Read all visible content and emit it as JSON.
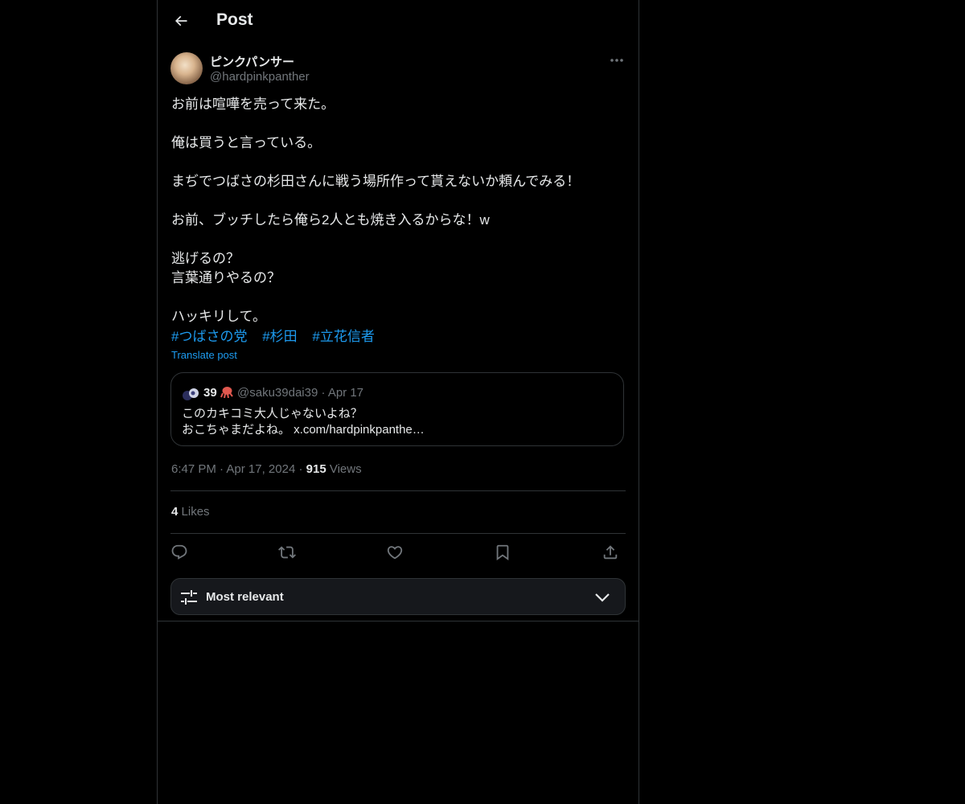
{
  "header": {
    "title": "Post"
  },
  "post": {
    "author": {
      "name": "ピンクパンサー",
      "handle": "@hardpinkpanther"
    },
    "lines": [
      "お前は喧嘩を売って来た。",
      "",
      "俺は買うと言っている。",
      "",
      "まぢでつばさの杉田さんに戦う場所作って貰えないか頼んでみる！",
      "",
      "お前、ブッチしたら俺ら2人とも焼き入るからな！w",
      "",
      "逃げるの？",
      "言葉通りやるの？",
      "",
      "ハッキリして。"
    ],
    "hashtags": [
      "#つばさの党",
      "#杉田",
      "#立花信者"
    ],
    "translate_label": "Translate post",
    "time": "6:47 PM",
    "date": "Apr 17, 2024",
    "views_count": "915",
    "views_label": "Views",
    "likes_count": "4",
    "likes_label": "Likes"
  },
  "quote": {
    "name": "39",
    "handle": "@saku39dai39",
    "date": "Apr 17",
    "line1": "このカキコミ大人じゃないよね？",
    "line2": "おこちゃまだよね。 x.com/hardpinkpanthe…"
  },
  "sort": {
    "label": "Most relevant"
  },
  "icons": {
    "back": "arrow-left-icon",
    "more": "more-horizontal-icon",
    "reply": "reply-icon",
    "repost": "repost-icon",
    "like": "heart-icon",
    "bookmark": "bookmark-icon",
    "share": "share-icon",
    "sort": "sliders-icon",
    "chevron": "chevron-down-icon"
  },
  "colors": {
    "background": "#000000",
    "text": "#e7e9ea",
    "secondary": "#71767b",
    "accent": "#1d9bf0",
    "border": "#2f3336"
  }
}
